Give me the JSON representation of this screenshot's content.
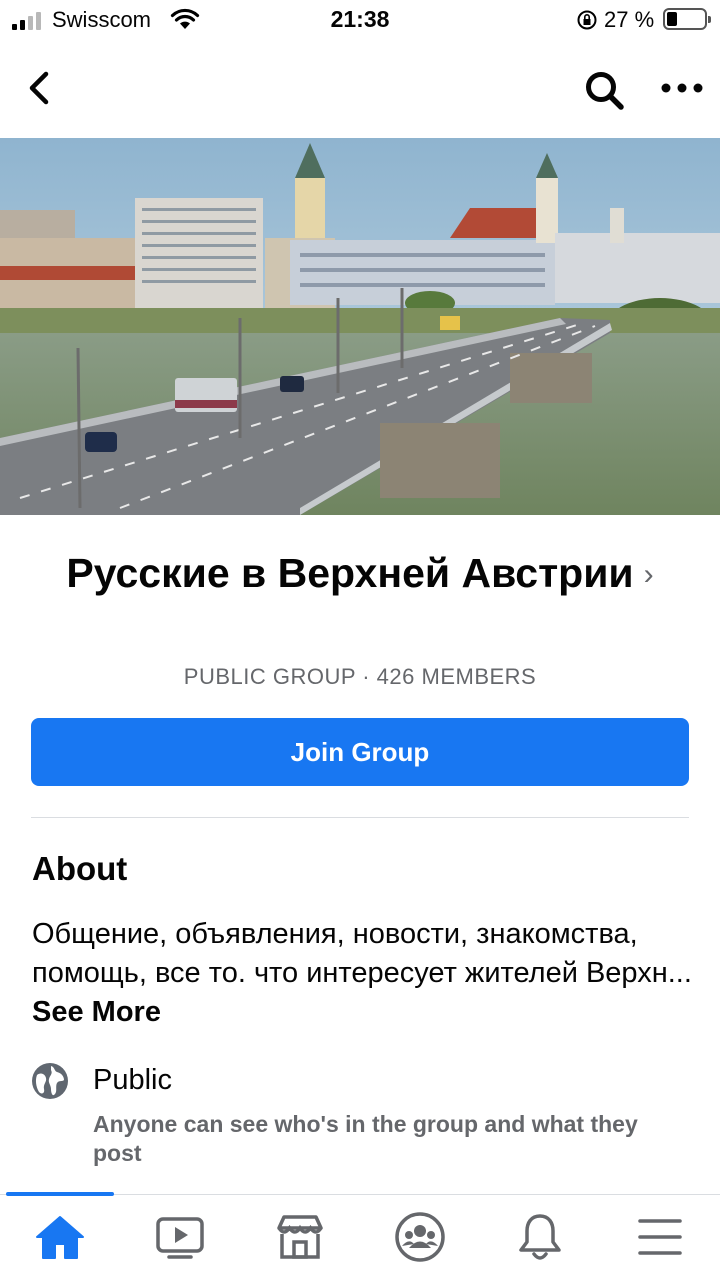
{
  "status_bar": {
    "carrier": "Swisscom",
    "time": "21:38",
    "battery_percent": "27 %",
    "battery_level": 0.27,
    "signal_bars": 2
  },
  "nav": {
    "back_icon": "chevron-left-icon",
    "search_icon": "search-icon",
    "more_icon": "more-dots-icon"
  },
  "group": {
    "cover_image": "bridge-over-river-city-photo",
    "title": "Русские в Верхней Австрии",
    "title_chevron": "›",
    "meta": "PUBLIC GROUP · 426 MEMBERS",
    "join_label": "Join Group"
  },
  "about": {
    "heading": "About",
    "description": "Общение, объявления, новости, знакомства, помощь, все то. что интересует  жителей Верхн...",
    "see_more": "See More",
    "privacy_label": "Public",
    "privacy_description": "Anyone can see who's in the group and what they post",
    "privacy_icon": "globe-icon"
  },
  "tabs": [
    {
      "name": "home",
      "icon": "home-icon",
      "active": true
    },
    {
      "name": "watch",
      "icon": "video-icon",
      "active": false
    },
    {
      "name": "marketplace",
      "icon": "store-icon",
      "active": false
    },
    {
      "name": "groups",
      "icon": "groups-icon",
      "active": false
    },
    {
      "name": "notifications",
      "icon": "bell-icon",
      "active": false
    },
    {
      "name": "menu",
      "icon": "menu-icon",
      "active": false
    }
  ],
  "colors": {
    "accent": "#1877f2",
    "secondary_text": "#65676b",
    "divider": "#dadde1"
  }
}
